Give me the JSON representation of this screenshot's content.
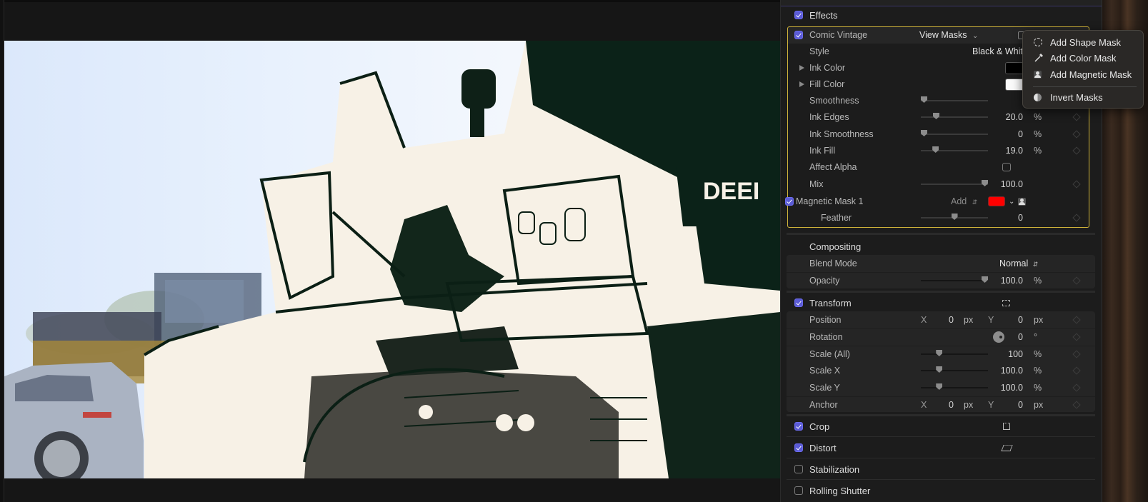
{
  "viewer": {
    "image_description": "Comic Vintage effect applied to bulldozer photo (black & white ink), left portion shows unaffected parked car and loader",
    "brand_text": "DEEI"
  },
  "inspector": {
    "effects": {
      "label": "Effects",
      "checked": true,
      "effect": {
        "name": "Comic Vintage",
        "checked": true,
        "view_masks_label": "View Masks",
        "style": {
          "label": "Style",
          "value": "Black & White"
        },
        "ink_color": {
          "label": "Ink Color",
          "color": "#000000"
        },
        "fill_color": {
          "label": "Fill Color",
          "color": "#ffffff"
        },
        "smoothness": {
          "label": "Smoothness",
          "value": "",
          "unit": "",
          "slider": 0.0
        },
        "ink_edges": {
          "label": "Ink Edges",
          "value": "20.0",
          "unit": "%",
          "slider": 0.2
        },
        "ink_smoothness": {
          "label": "Ink Smoothness",
          "value": "0",
          "unit": "%",
          "slider": 0.0
        },
        "ink_fill": {
          "label": "Ink Fill",
          "value": "19.0",
          "unit": "%",
          "slider": 0.19
        },
        "affect_alpha": {
          "label": "Affect Alpha",
          "checked": false
        },
        "mix": {
          "label": "Mix",
          "value": "100.0",
          "slider": 1.0
        },
        "mask": {
          "name": "Magnetic Mask 1",
          "checked": true,
          "mode": "Add",
          "color": "#ff0000",
          "feather": {
            "label": "Feather",
            "value": "0",
            "slider": 0.5
          }
        }
      }
    },
    "compositing": {
      "label": "Compositing",
      "blend_mode": {
        "label": "Blend Mode",
        "value": "Normal"
      },
      "opacity": {
        "label": "Opacity",
        "value": "100.0",
        "unit": "%",
        "slider": 1.0
      }
    },
    "transform": {
      "label": "Transform",
      "checked": true,
      "position": {
        "label": "Position",
        "x_label": "X",
        "x": "0",
        "x_unit": "px",
        "y_label": "Y",
        "y": "0",
        "y_unit": "px"
      },
      "rotation": {
        "label": "Rotation",
        "value": "0",
        "unit": "°"
      },
      "scale_all": {
        "label": "Scale (All)",
        "value": "100",
        "unit": "%",
        "slider": 0.25
      },
      "scale_x": {
        "label": "Scale X",
        "value": "100.0",
        "unit": "%",
        "slider": 0.25
      },
      "scale_y": {
        "label": "Scale Y",
        "value": "100.0",
        "unit": "%",
        "slider": 0.25
      },
      "anchor": {
        "label": "Anchor",
        "x_label": "X",
        "x": "0",
        "x_unit": "px",
        "y_label": "Y",
        "y": "0",
        "y_unit": "px"
      }
    },
    "crop": {
      "label": "Crop",
      "checked": true
    },
    "distort": {
      "label": "Distort",
      "checked": true
    },
    "stabilization": {
      "label": "Stabilization",
      "checked": false
    },
    "rolling_shutter": {
      "label": "Rolling Shutter",
      "checked": false
    }
  },
  "mask_menu": {
    "items": [
      {
        "label": "Add Shape Mask",
        "icon": "dashed-circle-icon"
      },
      {
        "label": "Add Color Mask",
        "icon": "eyedropper-icon"
      },
      {
        "label": "Add Magnetic Mask",
        "icon": "person-silhouette-icon"
      },
      {
        "label": "Invert Masks",
        "icon": "half-circle-icon"
      }
    ]
  }
}
